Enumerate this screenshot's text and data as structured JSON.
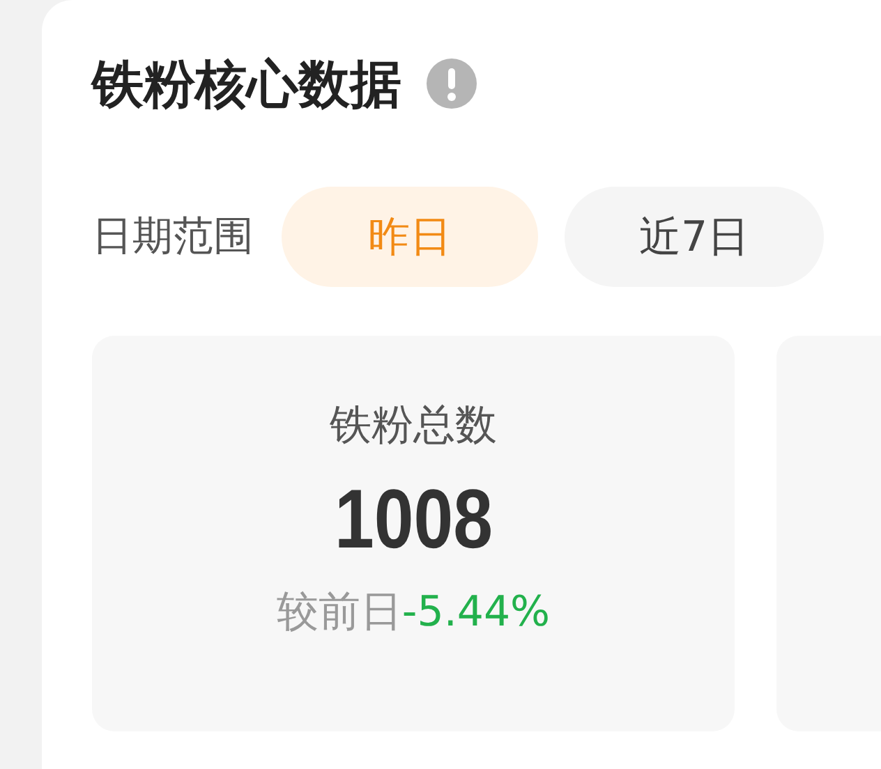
{
  "title": "铁粉核心数据",
  "date_range": {
    "label": "日期范围",
    "options": [
      {
        "label": "昨日",
        "selected": true
      },
      {
        "label": "近7日",
        "selected": false
      }
    ]
  },
  "stats": [
    {
      "label": "铁粉总数",
      "value": "1008",
      "compare_label": "较前日",
      "change": "-5.44%"
    }
  ]
}
